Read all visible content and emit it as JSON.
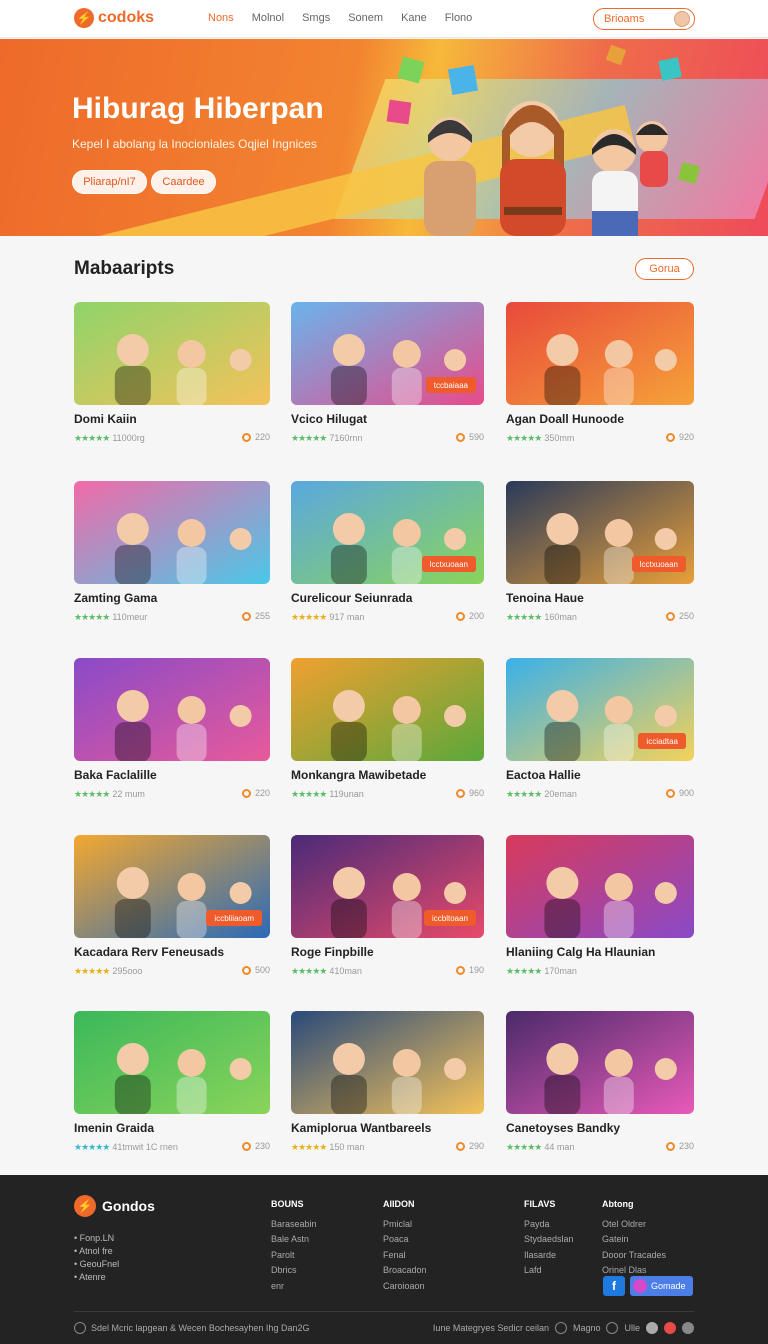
{
  "header": {
    "logo_text": "codoks",
    "nav": [
      "Nons",
      "Molnol",
      "Smgs",
      "Sonem",
      "Kane",
      "Flono"
    ],
    "cta": "Brioams"
  },
  "hero": {
    "title": "Hiburag Hiberpan",
    "subtitle": "Kepel I abolang la Inocioniales Oqjiel Ingnices",
    "btn_primary": "Pliarap/nI7",
    "btn_secondary": "Caardee"
  },
  "section": {
    "title": "Mabaaripts",
    "more": "Gorua"
  },
  "cards": [
    {
      "title": "Domi Kaiin",
      "meta": "11000rg",
      "count": "220",
      "stars": "green",
      "badge": ""
    },
    {
      "title": "Vcico Hilugat",
      "meta": "7160rnn",
      "count": "590",
      "stars": "green",
      "badge": "tccbaiaaa"
    },
    {
      "title": "Agan Doall Hunoode",
      "meta": "350mm",
      "count": "920",
      "stars": "green",
      "badge": ""
    },
    {
      "title": "Zamting Gama",
      "meta": "110meur",
      "count": "255",
      "stars": "green",
      "badge": ""
    },
    {
      "title": "Curelicour Seiunrada",
      "meta": "917 man",
      "count": "200",
      "stars": "gold",
      "badge": "lcctxuoaan"
    },
    {
      "title": "Tenoina Haue",
      "meta": "160man",
      "count": "250",
      "stars": "green",
      "badge": "lcctxuoaan"
    },
    {
      "title": "Baka Faclalille",
      "meta": "22 mum",
      "count": "220",
      "stars": "green",
      "badge": ""
    },
    {
      "title": "Monkangra Mawibetade",
      "meta": "119unan",
      "count": "960",
      "stars": "green",
      "badge": ""
    },
    {
      "title": "Eactoa Hallie",
      "meta": "20eman",
      "count": "900",
      "stars": "green",
      "badge": "icciadtaa"
    },
    {
      "title": "Kacadara Rerv Feneusads",
      "meta": "295ooo",
      "count": "500",
      "stars": "gold",
      "badge": "iccbliiaoam"
    },
    {
      "title": "Roge Finpbille",
      "meta": "410man",
      "count": "190",
      "stars": "green",
      "badge": "iccbltoaan"
    },
    {
      "title": "Hlaniing Calg Ha Hlaunian",
      "meta": "170man",
      "count": "",
      "stars": "green",
      "badge": ""
    },
    {
      "title": "Imenin Graida",
      "meta": "41tmwit 1C rnen",
      "count": "230",
      "stars": "teal",
      "badge": ""
    },
    {
      "title": "Kamiplorua Wantbareels",
      "meta": "150 man",
      "count": "290",
      "stars": "gold",
      "badge": ""
    },
    {
      "title": "Canetoyses Bandky",
      "meta": "44 man",
      "count": "230",
      "stars": "green",
      "badge": ""
    }
  ],
  "colors": {
    "accent": "#ef6a2a",
    "footer_bg": "#232323"
  },
  "footer": {
    "logo_text": "Gondos",
    "bullets": [
      "• Fonp.LN",
      "• Atnol fre",
      "• GeouFnel",
      "• Atenre"
    ],
    "col1": {
      "head": "BOUNS",
      "items": [
        "Baraseabin",
        "Bale Astn",
        "Parolt",
        "Dbrics",
        "enr"
      ]
    },
    "col2": {
      "head": "AIIDON",
      "items": [
        "Pmiclal",
        "Poaca",
        "Fenal",
        "Broacadon",
        "Caroioaon"
      ]
    },
    "col3": {
      "head": "FILAVS",
      "items": [
        "Payda",
        "Stydaedslan",
        "Ilasarde",
        "Lafd"
      ]
    },
    "col4": {
      "head": "Abtong",
      "items": [
        "Otel Oldrer",
        "Gatein",
        "Dooor Tracades",
        "Orinel Dlas"
      ]
    },
    "social_pill": "Gomade",
    "copyright": "Sdel Mcric lapgean & Wecen Bochesayhen Ihg Dan2G",
    "right_text": "Iune Mategryes Sedicr ceilan",
    "right_link": "Magno",
    "right_tail": "Ulle"
  }
}
